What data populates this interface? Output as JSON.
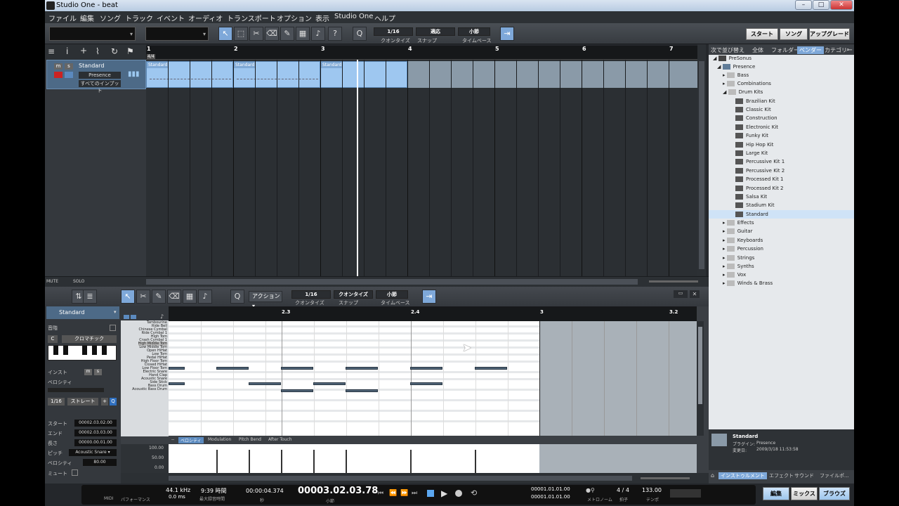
{
  "window": {
    "title": "Studio One - beat"
  },
  "menu": [
    "ファイル",
    "編集",
    "ソング",
    "トラック",
    "イベント",
    "オーディオ",
    "トランスポート",
    "オプション",
    "表示",
    "Studio One",
    "ヘルプ"
  ],
  "toolbar": {
    "quantize_value": "1/16",
    "quantize_label": "クオンタイズ",
    "snap_value": "適応",
    "snap_label": "スナップ",
    "timebase_value": "小節",
    "timebase_label": "タイムベース",
    "q_label": "Q",
    "help_label": "?",
    "start_label": "スタート",
    "song_label": "ソング",
    "upgrade_label": "アップグレード"
  },
  "track": {
    "m": "m",
    "s": "s",
    "name": "Standard",
    "instrument": "Presence",
    "input": "すべてのインプット"
  },
  "ruler_bars": [
    "1",
    "2",
    "3",
    "4",
    "5",
    "6",
    "7"
  ],
  "ruler_sig": "4/4",
  "parts": [
    {
      "label": "Standard"
    },
    {
      "label": "Standard"
    },
    {
      "label": "Standard"
    }
  ],
  "arranger_footer": {
    "mute": "MUTE",
    "solo": "SOLO"
  },
  "browser": {
    "tabs": [
      "次で並び替え",
      "全体",
      "フォルダー",
      "ベンダー",
      "カテゴリー"
    ],
    "tree": [
      "PreSonus",
      "Presence",
      "Bass",
      "Combinations",
      "Drum Kits",
      "Brazilian Kit",
      "Classic Kit",
      "Construction",
      "Electronic Kit",
      "Funky Kit",
      "Hip Hop Kit",
      "Large Kit",
      "Percussive Kit 1",
      "Percussive Kit 2",
      "Processed Kit 1",
      "Processed Kit 2",
      "Salsa Kit",
      "Stadium Kit",
      "Standard",
      "Effects",
      "Guitar",
      "Keyboards",
      "Percussion",
      "Strings",
      "Synths",
      "Vox",
      "Winds & Brass"
    ],
    "info_name": "Standard",
    "info_plugin_label": "プラグイン:",
    "info_plugin": "Presence",
    "info_date_label": "変更日:",
    "info_date": "2009/3/18 11:53:58",
    "bottom_tabs": [
      "インストゥルメント",
      "エフェクト",
      "サウンド",
      "ファイル",
      "ポ..."
    ]
  },
  "editor": {
    "action_label": "アクション",
    "quantize_value": "1/16",
    "quantize_label": "クオンタイズ",
    "snap_value": "クオンタイズ",
    "snap_label": "スナップ",
    "timebase_value": "小節",
    "timebase_label": "タイムベース",
    "q_label": "Q",
    "track_name": "Standard",
    "ruler": [
      "2.3",
      "2.4",
      "3",
      "3.2"
    ],
    "key_labels": [
      "Tambourine",
      "Ride Bell",
      "Chinese Cymbal",
      "Ride Cymbal 1",
      "High Tom",
      "Crash Cymbal 1",
      "High Middle Tom",
      "Low Middle Tom",
      "Open HiHat",
      "Low Tom",
      "Pedal HiHat",
      "High Floor Tom",
      "Closed HiHat",
      "Low Floor Tom",
      "Electric Snare",
      "Hand Clap",
      "Acoustic Snare",
      "Side Stick",
      "Bass Drum",
      "Acoustic Bass Drum"
    ],
    "vel_tabs": [
      "ベロシティ",
      "Modulation",
      "Pitch Bend",
      "After Touch"
    ],
    "vel_scale": [
      "100.00",
      "50.00",
      "0.00"
    ],
    "dash": "--"
  },
  "inspector": {
    "scale_label": "音階",
    "key": "C",
    "scale": "クロマチック",
    "instrument_label": "インスト",
    "m": "m",
    "s": "s",
    "velocity_label": "ベロシティ",
    "grid_value": "1/16",
    "grid_mode": "ストレート",
    "plus": "+",
    "q": "Q",
    "start_label": "スタート",
    "start": "00002.03.02.00",
    "end_label": "エンド",
    "end": "00002.03.03.00",
    "length_label": "長さ",
    "length": "00000.00.01.00",
    "pitch_label": "ピッチ",
    "pitch": "Acoustic Snare",
    "vel_label": "ベロシティ",
    "vel": "80.00",
    "mute_label": "ミュート"
  },
  "transport": {
    "midi": "MIDI",
    "perf": "パフォーマンス",
    "rate": "44.1 kHz",
    "latency": "0.0 ms",
    "rec_time": "9:39 時間",
    "rec_label": "最大録音時間",
    "seconds": "00:00:04.374",
    "seconds_label": "秒",
    "position": "00003.02.03.78",
    "position_label": "小節",
    "loop_start": "00001.01.01.00",
    "loop_end": "00001.01.01.00",
    "metronome_label": "メトロノーム",
    "sig": "4 / 4",
    "sig_label": "拍子",
    "tempo": "133.00",
    "tempo_label": "テンポ",
    "edit": "編集",
    "mix": "ミックス",
    "browse": "ブラウズ"
  }
}
